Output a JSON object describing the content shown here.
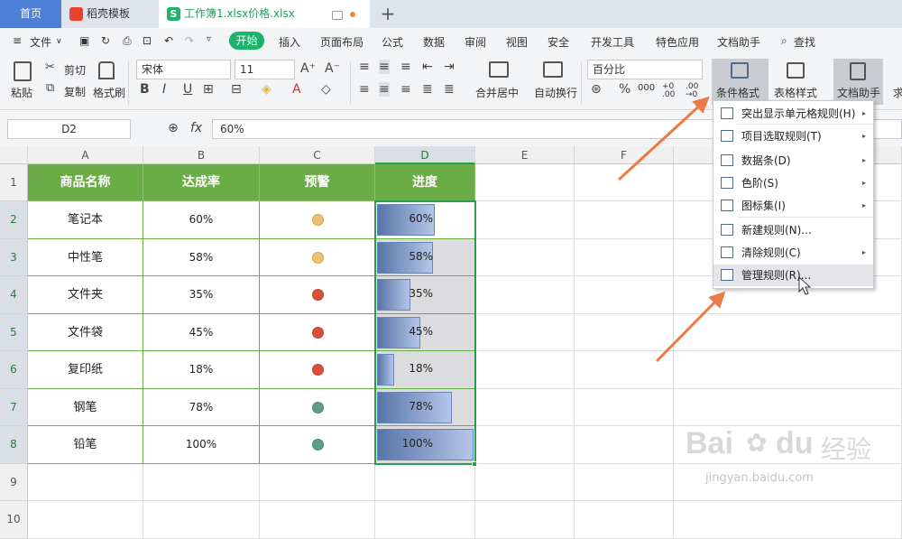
{
  "tabs": {
    "home": "首页",
    "templates": "稻壳模板",
    "document": "工作簿1.xlsx价格.xlsx"
  },
  "menu": {
    "file": "文件",
    "start": "开始",
    "items": [
      "插入",
      "页面布局",
      "公式",
      "数据",
      "审阅",
      "视图",
      "安全",
      "开发工具",
      "特色应用",
      "文档助手"
    ],
    "search": "查找"
  },
  "ribbon": {
    "paste": "粘贴",
    "cut": "剪切",
    "copy": "复制",
    "format_painter": "格式刷",
    "font_name": "宋体",
    "font_size": "11",
    "bold": "B",
    "italic": "I",
    "underline": "U",
    "merge_center": "合并居中",
    "wrap_text": "自动换行",
    "number_format": "百分比",
    "percent": "%",
    "thousands": "000",
    "dec_inc": "+0 .00",
    "dec_dec": ".00 →0",
    "conditional_format": "条件格式",
    "table_style": "表格样式",
    "doc_assistant": "文档助手",
    "extra": "求"
  },
  "formula_bar": {
    "name_box": "D2",
    "fx": "fx",
    "content": "60%"
  },
  "sheet": {
    "columns": [
      "A",
      "B",
      "C",
      "D",
      "E",
      "F"
    ],
    "row_numbers": [
      "1",
      "2",
      "3",
      "4",
      "5",
      "6",
      "7",
      "8",
      "9",
      "10"
    ],
    "headers": [
      "商品名称",
      "达成率",
      "预警",
      "进度"
    ],
    "rows": [
      {
        "name": "笔记本",
        "rate": "60%",
        "warn": "#efc16f",
        "progress": 0.6,
        "progress_label": "60%"
      },
      {
        "name": "中性笔",
        "rate": "58%",
        "warn": "#efc16f",
        "progress": 0.58,
        "progress_label": "58%"
      },
      {
        "name": "文件夹",
        "rate": "35%",
        "warn": "#d9503a",
        "progress": 0.35,
        "progress_label": "35%"
      },
      {
        "name": "文件袋",
        "rate": "45%",
        "warn": "#d9503a",
        "progress": 0.45,
        "progress_label": "45%"
      },
      {
        "name": "复印纸",
        "rate": "18%",
        "warn": "#d9503a",
        "progress": 0.18,
        "progress_label": "18%"
      },
      {
        "name": "钢笔",
        "rate": "78%",
        "warn": "#5e9e84",
        "progress": 0.78,
        "progress_label": "78%"
      },
      {
        "name": "铅笔",
        "rate": "100%",
        "warn": "#5e9e84",
        "progress": 1.0,
        "progress_label": "100%"
      }
    ]
  },
  "dropdown": {
    "items": [
      {
        "label": "突出显示单元格规则(H)",
        "submenu": true
      },
      {
        "label": "项目选取规则(T)",
        "submenu": true
      },
      {
        "label": "数据条(D)",
        "submenu": true
      },
      {
        "label": "色阶(S)",
        "submenu": true
      },
      {
        "label": "图标集(I)",
        "submenu": true
      },
      {
        "label": "新建规则(N)...",
        "submenu": false
      },
      {
        "label": "清除规则(C)",
        "submenu": true
      },
      {
        "label": "管理规则(R)...",
        "submenu": false
      }
    ],
    "submenu_arrow": "▸"
  },
  "watermark": {
    "brand": "Bai",
    "brand2": "du",
    "cn": "经验",
    "url": "jingyan.baidu.com"
  },
  "colors": {
    "accent": "#1db36a",
    "header_fill": "#6aac46",
    "arrow": "#ec7a45"
  }
}
